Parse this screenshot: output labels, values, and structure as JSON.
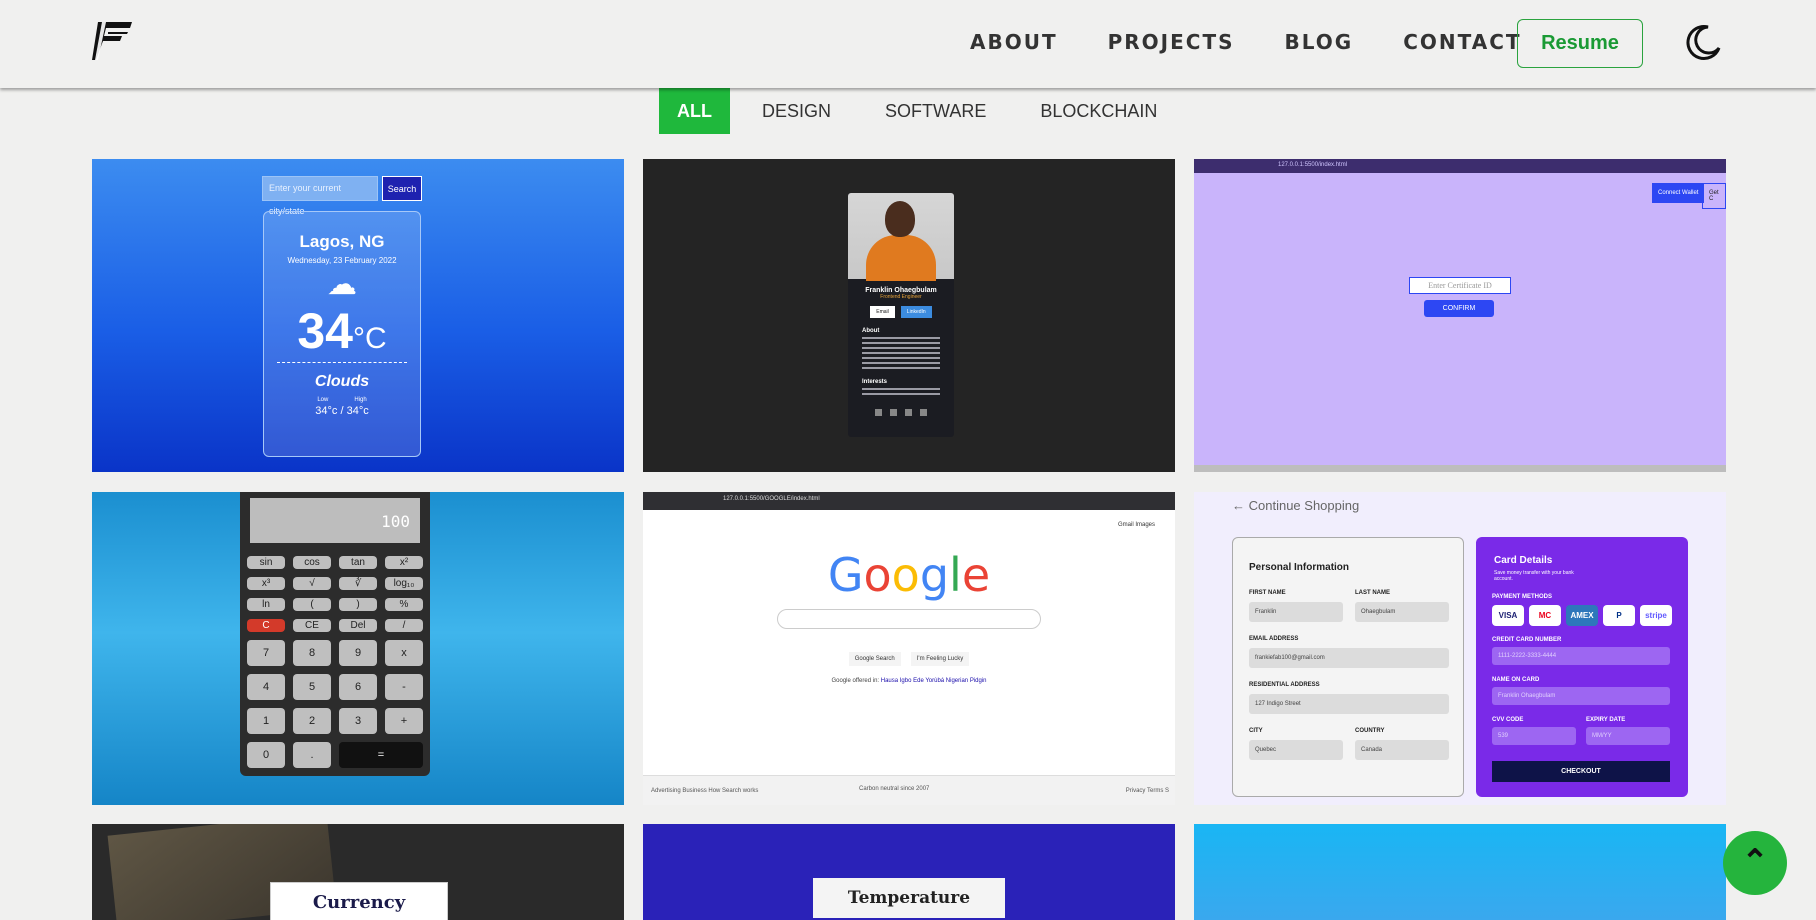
{
  "header": {
    "logo": "FF",
    "nav": [
      {
        "label": "ABOUT"
      },
      {
        "label": "PROJECTS"
      },
      {
        "label": "BLOG"
      },
      {
        "label": "CONTACT"
      }
    ],
    "resume_label": "Resume",
    "theme_icon": "moon-icon"
  },
  "filters": {
    "tabs": [
      "ALL",
      "DESIGN",
      "SOFTWARE",
      "BLOCKCHAIN"
    ],
    "active": "ALL"
  },
  "colors": {
    "accent": "#1fb83c",
    "background": "#f0f0ef"
  },
  "projects": {
    "weather": {
      "placeholder": "Enter your current city/state",
      "search_label": "Search",
      "city": "Lagos, NG",
      "date": "Wednesday, 23 February 2022",
      "temp": "34",
      "unit": "°C",
      "desc": "Clouds",
      "low_label": "Low",
      "high_label": "High",
      "range": "34°c / 34°c"
    },
    "profile": {
      "name": "Franklin Ohaegbulam",
      "role": "Frontend Engineer",
      "email_btn": "Email",
      "linkedin_btn": "LinkedIn",
      "about_title": "About",
      "interests_title": "Interests"
    },
    "certificate": {
      "url": "127.0.0.1:5500/index.html",
      "connect_label": "Connect Wallet",
      "get_label": "Get C",
      "input_placeholder": "Enter Certificate ID",
      "confirm_label": "CONFIRM"
    },
    "calculator": {
      "display": "100",
      "sci_rows": [
        [
          "sin",
          "cos",
          "tan",
          "x²"
        ],
        [
          "x³",
          "√",
          "∛",
          "log₁₀"
        ],
        [
          "ln",
          "(",
          ")",
          "%"
        ],
        [
          "C",
          "CE",
          "Del",
          "/"
        ]
      ],
      "num_rows": [
        [
          "7",
          "8",
          "9",
          "x"
        ],
        [
          "4",
          "5",
          "6",
          "-"
        ],
        [
          "1",
          "2",
          "3",
          "+"
        ]
      ],
      "last_row": [
        "0",
        ".",
        "="
      ]
    },
    "google": {
      "url": "127.0.0.1:5500/GOOGLE/index.html",
      "top_links": "Gmail  Images",
      "logo": "Google",
      "search_btn": "Google Search",
      "lucky_btn": "I'm Feeling Lucky",
      "offered_in": "Google offered in:",
      "languages": "Hausa  Igbo  Ede Yorùbá  Nigerian Pidgin",
      "footer_left": "Advertising    Business    How Search works",
      "footer_mid": "Carbon neutral since 2007",
      "footer_right": "Privacy    Terms    S"
    },
    "checkout": {
      "back_label": "Continue Shopping",
      "personal_title": "Personal Information",
      "first_name_label": "FIRST NAME",
      "first_name": "Franklin",
      "last_name_label": "LAST NAME",
      "last_name": "Ohaegbulam",
      "email_label": "EMAIL ADDRESS",
      "email": "frankiefab100@gmail.com",
      "address_label": "RESIDENTIAL ADDRESS",
      "address": "127 Indigo Street",
      "city_label": "CITY",
      "city": "Quebec",
      "country_label": "COUNTRY",
      "country": "Canada",
      "card_title": "Card Details",
      "card_sub": "Save money transfer with your bank account.",
      "methods_label": "PAYMENT METHODS",
      "methods": [
        "VISA",
        "MC",
        "AMEX",
        "P",
        "stripe"
      ],
      "cc_label": "CREDIT CARD NUMBER",
      "cc": "1111-2222-3333-4444",
      "noc_label": "NAME ON CARD",
      "noc": "Franklin Ohaegbulam",
      "cvv_label": "CVV CODE",
      "cvv": "539",
      "exp_label": "EXPIRY DATE",
      "exp": "MM/YY",
      "checkout_label": "CHECKOUT"
    },
    "currency": {
      "label": "Currency Converter"
    },
    "temperature": {
      "label": "Temperature Converter"
    }
  },
  "back_to_top_icon": "chevron-up-icon"
}
